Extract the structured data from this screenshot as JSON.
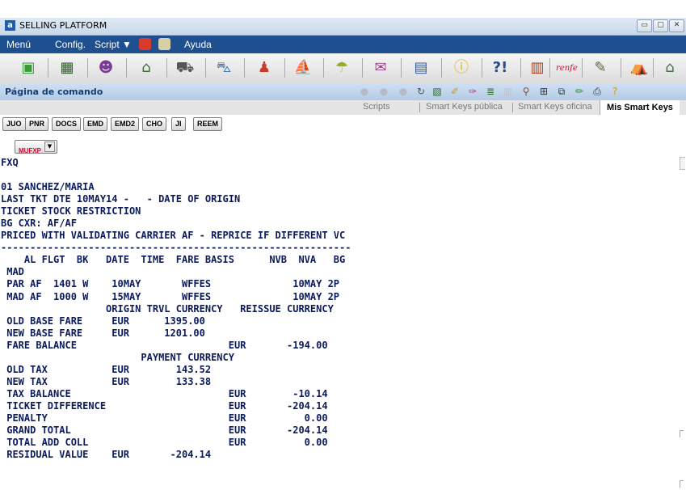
{
  "window": {
    "title": "SELLING PLATFORM",
    "app_icon": "a"
  },
  "menu": {
    "items": [
      "Menú",
      "Config.",
      "Script ▼",
      "Ayuda"
    ]
  },
  "toolbar": {
    "renfe_label": "renfe"
  },
  "command_page": {
    "title": "Página de comando"
  },
  "tabs": [
    "Scripts",
    "Smart Keys pública",
    "Smart Keys oficina",
    "Mis Smart Keys"
  ],
  "smart_keys": [
    "JUO",
    "PNR",
    "DOCS",
    "EMD",
    "EMD2",
    "CHO",
    "JI",
    "REEM"
  ],
  "mufxp": "MUFXP",
  "terminal": {
    "lines": [
      "FXQ",
      "",
      "01 SANCHEZ/MARIA",
      "LAST TKT DTE 10MAY14 -   - DATE OF ORIGIN",
      "TICKET STOCK RESTRICTION",
      "BG CXR: AF/AF",
      "PRICED WITH VALIDATING CARRIER AF - REPRICE IF DIFFERENT VC",
      "------------------------------------------------------------",
      "    AL FLGT  BK   DATE  TIME  FARE BASIS      NVB  NVA   BG",
      " MAD",
      " PAR AF  1401 W    10MAY       WFFES              10MAY 2P",
      " MAD AF  1000 W    15MAY       WFFES              10MAY 2P",
      "                  ORIGIN TRVL CURRENCY   REISSUE CURRENCY",
      " OLD BASE FARE     EUR      1395.00",
      " NEW BASE FARE     EUR      1201.00",
      " FARE BALANCE                          EUR       -194.00",
      "                        PAYMENT CURRENCY",
      " OLD TAX           EUR        143.52",
      " NEW TAX           EUR        133.38",
      " TAX BALANCE                           EUR        -10.14",
      " TICKET DIFFERENCE                     EUR       -204.14",
      " PENALTY                               EUR          0.00",
      " GRAND TOTAL                           EUR       -204.14",
      " TOTAL ADD COLL                        EUR          0.00",
      " RESIDUAL VALUE    EUR       -204.14"
    ]
  }
}
